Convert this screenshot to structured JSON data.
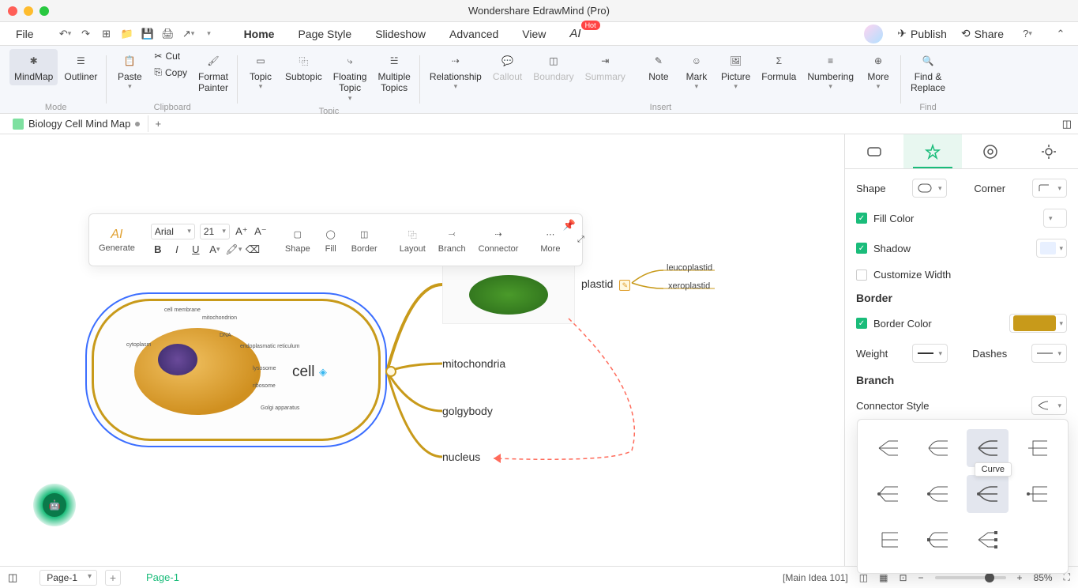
{
  "window": {
    "title": "Wondershare EdrawMind (Pro)"
  },
  "menubar": {
    "file": "File",
    "tabs": [
      "Home",
      "Page Style",
      "Slideshow",
      "Advanced",
      "View"
    ],
    "ai": "AI",
    "hot": "Hot",
    "publish": "Publish",
    "share": "Share"
  },
  "ribbon": {
    "mode": {
      "label": "Mode",
      "mindmap": "MindMap",
      "outliner": "Outliner"
    },
    "clipboard": {
      "label": "Clipboard",
      "paste": "Paste",
      "cut": "Cut",
      "copy": "Copy",
      "format_painter": "Format\nPainter"
    },
    "topic": {
      "label": "Topic",
      "topic": "Topic",
      "subtopic": "Subtopic",
      "floating": "Floating\nTopic",
      "multiple": "Multiple\nTopics"
    },
    "insert": {
      "label": "Insert",
      "relationship": "Relationship",
      "callout": "Callout",
      "boundary": "Boundary",
      "summary": "Summary",
      "note": "Note",
      "mark": "Mark",
      "picture": "Picture",
      "formula": "Formula",
      "numbering": "Numbering",
      "more": "More"
    },
    "find": {
      "label": "Find",
      "find_replace": "Find &\nReplace"
    }
  },
  "doctabs": {
    "name": "Biology Cell Mind Map"
  },
  "float_toolbar": {
    "ai": "AI",
    "generate": "Generate",
    "font": "Arial",
    "size": "21",
    "shape": "Shape",
    "fill": "Fill",
    "border": "Border",
    "layout": "Layout",
    "branch": "Branch",
    "connector": "Connector",
    "more": "More"
  },
  "canvas": {
    "cell": "cell",
    "plastid": "plastid",
    "leucoplastid": "leucoplastid",
    "xeroplastid": "xeroplastid",
    "mitochondria": "mitochondria",
    "golgybody": "golgybody",
    "nucleus": "nucleus",
    "cell_labels": {
      "membrane": "cell membrane",
      "cytoplasm": "cytoplasm",
      "mitochondrion": "mitochondrion",
      "dna": "DNA",
      "er": "endoplasmatic\nreticulum",
      "lysosome": "lysosome",
      "ribosome": "ribosome",
      "golgi": "Golgi\napparatus"
    }
  },
  "right_panel": {
    "shape": "Shape",
    "corner": "Corner",
    "fill_color": "Fill Color",
    "shadow": "Shadow",
    "customize_width": "Customize Width",
    "border": "Border",
    "border_color": "Border Color",
    "weight": "Weight",
    "dashes": "Dashes",
    "branch": "Branch",
    "connector_style": "Connector Style",
    "border_color_value": "#c89a1a"
  },
  "connector_tooltip": "Curve",
  "statusbar": {
    "page": "Page-1",
    "page_tab": "Page-1",
    "main_idea": "[Main Idea 101]",
    "zoom": "85%"
  }
}
